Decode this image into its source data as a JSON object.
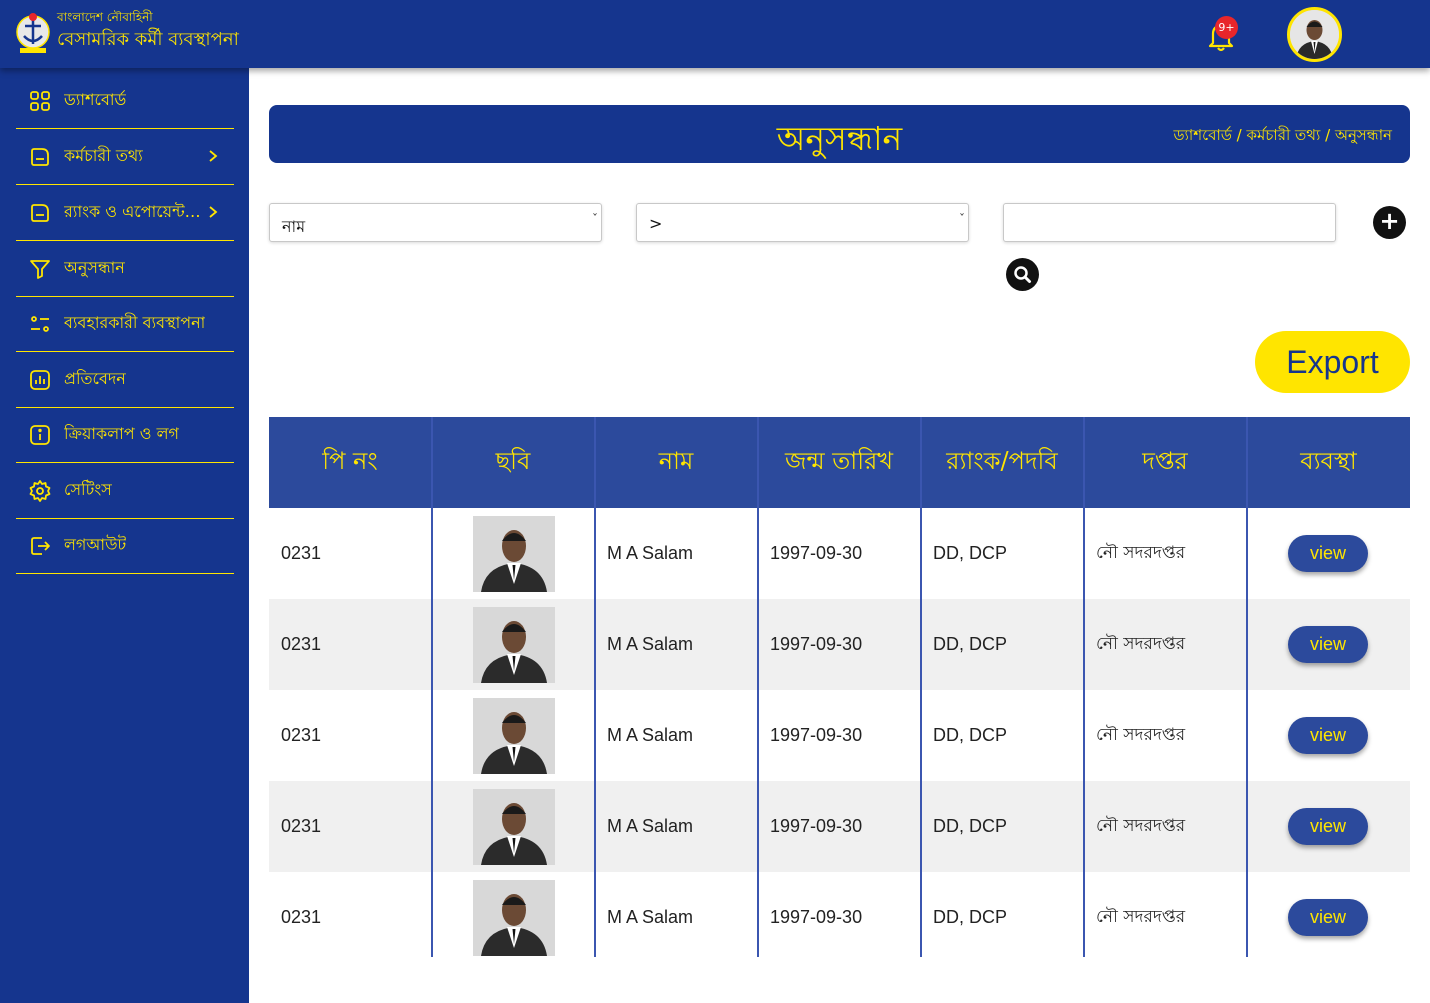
{
  "header": {
    "org": "বাংলাদেশ নৌবাহিনী",
    "app_title": "বেসামরিক কর্মী ব্যবস্থাপনা",
    "notification_count": "9+"
  },
  "sidebar": {
    "items": [
      {
        "label": "ড্যাশবোর্ড",
        "icon": "grid-icon"
      },
      {
        "label": "কর্মচারী তথ্য",
        "icon": "folder-icon",
        "has_submenu": true
      },
      {
        "label": "র‍্যাংক ও এপোয়েন্টমেন্ট",
        "icon": "folder-icon",
        "has_submenu": true
      },
      {
        "label": "অনুসন্ধান",
        "icon": "filter-icon"
      },
      {
        "label": "ব্যবহারকারী ব্যবস্থাপনা",
        "icon": "user-list-icon"
      },
      {
        "label": "প্রতিবেদন",
        "icon": "report-chart-icon"
      },
      {
        "label": "ক্রিয়াকলাপ ও লগ",
        "icon": "info-icon"
      },
      {
        "label": "সেটিংস",
        "icon": "gear-icon"
      },
      {
        "label": "লগআউট",
        "icon": "logout-icon"
      }
    ]
  },
  "page": {
    "title": "অনুসন্ধান",
    "breadcrumb": "ড্যাশবোর্ড / কর্মচারী তথ্য / অনুসন্ধান"
  },
  "search": {
    "field_value": "নাম",
    "operator_value": ">",
    "query_value": ""
  },
  "export_label": "Export",
  "table": {
    "headers": [
      "পি নং",
      "ছবি",
      "নাম",
      "জন্ম তারিখ",
      "র‍্যাংক/পদবি",
      "দপ্তর",
      "ব্যবস্থা"
    ],
    "rows": [
      {
        "p_no": "0231",
        "name": "M A Salam",
        "dob": "1997-09-30",
        "rank": "DD, DCP",
        "office": "নৌ সদরদপ্তর",
        "action": "view"
      },
      {
        "p_no": "0231",
        "name": "M A Salam",
        "dob": "1997-09-30",
        "rank": "DD, DCP",
        "office": "নৌ সদরদপ্তর",
        "action": "view"
      },
      {
        "p_no": "0231",
        "name": "M A Salam",
        "dob": "1997-09-30",
        "rank": "DD, DCP",
        "office": "নৌ সদরদপ্তর",
        "action": "view"
      },
      {
        "p_no": "0231",
        "name": "M A Salam",
        "dob": "1997-09-30",
        "rank": "DD, DCP",
        "office": "নৌ সদরদপ্তর",
        "action": "view"
      },
      {
        "p_no": "0231",
        "name": "M A Salam",
        "dob": "1997-09-30",
        "rank": "DD, DCP",
        "office": "নৌ সদরদপ্তর",
        "action": "view"
      }
    ]
  },
  "colors": {
    "primary": "#15358e",
    "table_header": "#2c4a9c",
    "accent": "#ffe500",
    "badge": "#e8262b"
  }
}
